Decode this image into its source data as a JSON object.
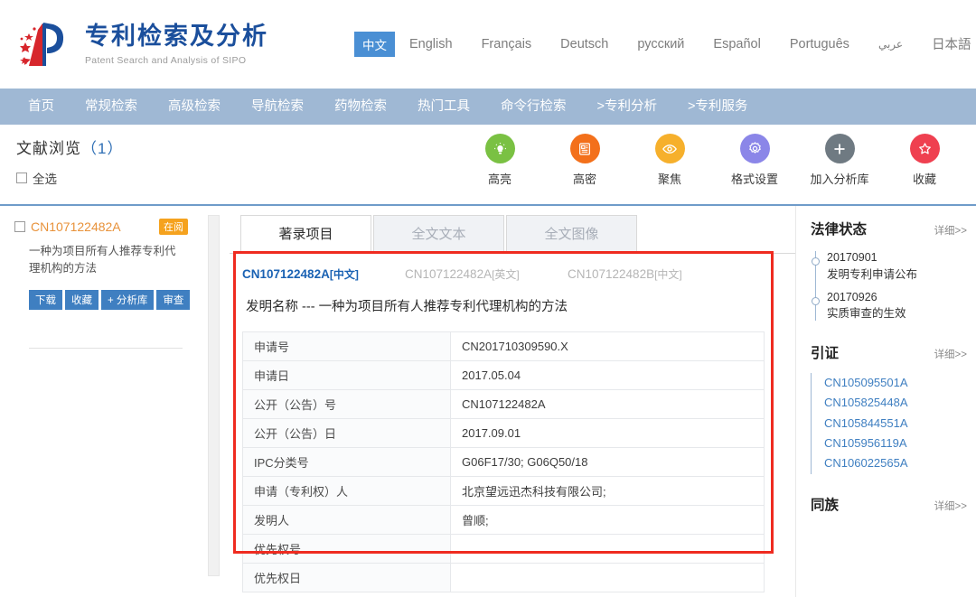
{
  "brand": {
    "title": "专利检索及分析",
    "subtitle": "Patent Search and Analysis of SIPO",
    "logo_icon": "sipo-p-logo-icon"
  },
  "languages": [
    {
      "label": "中文",
      "active": true
    },
    {
      "label": "English",
      "active": false
    },
    {
      "label": "Français",
      "active": false
    },
    {
      "label": "Deutsch",
      "active": false
    },
    {
      "label": "русский",
      "active": false
    },
    {
      "label": "Español",
      "active": false
    },
    {
      "label": "Português",
      "active": false
    },
    {
      "label": "عربي",
      "active": false
    },
    {
      "label": "日本語",
      "active": false
    }
  ],
  "nav": [
    {
      "label": "首页"
    },
    {
      "label": "常规检索"
    },
    {
      "label": "高级检索"
    },
    {
      "label": "导航检索"
    },
    {
      "label": "药物检索"
    },
    {
      "label": "热门工具"
    },
    {
      "label": "命令行检索"
    },
    {
      "label": ">专利分析"
    },
    {
      "label": ">专利服务"
    }
  ],
  "toolbar": {
    "title": "文献浏览",
    "count": "（1）",
    "select_all": "全选",
    "actions": [
      {
        "label": "高亮",
        "icon": "lightbulb-icon",
        "color": "#7ac143"
      },
      {
        "label": "高密",
        "icon": "document-grid-icon",
        "color": "#f3701b"
      },
      {
        "label": "聚焦",
        "icon": "eye-icon",
        "color": "#f6b02c"
      },
      {
        "label": "格式设置",
        "icon": "gear-icon",
        "color": "#8b86e8"
      },
      {
        "label": "加入分析库",
        "icon": "plus-icon",
        "color": "#6f7a82"
      },
      {
        "label": "收藏",
        "icon": "star-icon",
        "color": "#ef4050"
      }
    ]
  },
  "sidebar": {
    "doc_id": "CN107122482A",
    "badge": "在阅",
    "doc_title": "一种为项目所有人推荐专利代理机构的方法",
    "buttons": [
      {
        "label": "下载"
      },
      {
        "label": "收藏"
      },
      {
        "label": "+ 分析库"
      },
      {
        "label": "审查"
      }
    ]
  },
  "tabs": [
    {
      "label": "著录项目",
      "active": true
    },
    {
      "label": "全文文本",
      "active": false
    },
    {
      "label": "全文图像",
      "active": false
    }
  ],
  "versions": [
    {
      "id": "CN107122482A",
      "lang": "[中文]",
      "active": true
    },
    {
      "id": "CN107122482A",
      "lang": "[英文]",
      "active": false
    },
    {
      "id": "CN107122482B",
      "lang": "[中文]",
      "active": false
    }
  ],
  "invention": {
    "label": "发明名称",
    "sep": "---",
    "value": "一种为项目所有人推荐专利代理机构的方法"
  },
  "biblio": [
    {
      "key": "申请号",
      "value": "CN201710309590.X"
    },
    {
      "key": "申请日",
      "value": "2017.05.04"
    },
    {
      "key": "公开（公告）号",
      "value": "CN107122482A"
    },
    {
      "key": "公开（公告）日",
      "value": "2017.09.01"
    },
    {
      "key": "IPC分类号",
      "value": "G06F17/30; G06Q50/18"
    },
    {
      "key": "申请（专利权）人",
      "value": "北京望远迅杰科技有限公司;"
    },
    {
      "key": "发明人",
      "value": "曾顺;"
    },
    {
      "key": "优先权号",
      "value": ""
    },
    {
      "key": "优先权日",
      "value": ""
    }
  ],
  "right": {
    "legal": {
      "title": "法律状态",
      "more": "详细>>",
      "events": [
        {
          "date": "20170901",
          "desc": "发明专利申请公布"
        },
        {
          "date": "20170926",
          "desc": "实质审查的生效"
        }
      ]
    },
    "citation": {
      "title": "引证",
      "more": "详细>>",
      "items": [
        "CN105095501A",
        "CN105825448A",
        "CN105844551A",
        "CN105956119A",
        "CN106022565A"
      ]
    },
    "family": {
      "title": "同族",
      "more": "详细>>"
    }
  }
}
